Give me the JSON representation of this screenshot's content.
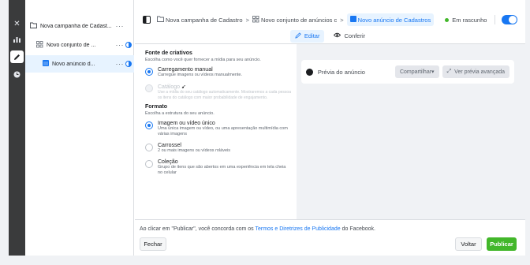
{
  "rail": {
    "close_icon": "close-icon",
    "chart_icon": "bar-chart-icon",
    "edit_icon": "pencil-icon",
    "history_icon": "clock-icon"
  },
  "tree": {
    "campaign": {
      "label": "Nova campanha de Cadast..."
    },
    "adset": {
      "label": "Novo conjunto de ..."
    },
    "ad": {
      "label": "Novo anúncio d..."
    },
    "more": "···"
  },
  "breadcrumb": {
    "campaign": "Nova campanha de Cadastro",
    "adset": "Novo conjunto de anúncios c",
    "ad": "Novo anúncio de Cadastros"
  },
  "status": {
    "label": "Em rascunho"
  },
  "tabs": {
    "edit": "Editar",
    "review": "Conferir"
  },
  "form": {
    "source_title": "Fonte de criativos",
    "source_desc": "Escolha como você quer fornecer a mídia para seu anúncio.",
    "manual_title": "Carregamento manual",
    "manual_desc": "Carregue imagens ou vídeos manualmente.",
    "catalog_title": "Catálogo",
    "catalog_desc": "Use a mídia do seu catálogo automaticamente. Mostraremos a cada pessoa os itens do catálogo com maior probabilidade de engajamento.",
    "format_title": "Formato",
    "format_desc": "Escolha a estrutura do seu anúncio.",
    "single_title": "Imagem ou vídeo único",
    "single_desc": "Uma única imagem ou vídeo, ou uma apresentação multimídia com várias imagens",
    "carousel_title": "Carrossel",
    "carousel_desc": "2 ou mais imagens ou vídeos roláveis",
    "collection_title": "Coleção",
    "collection_desc": "Grupo de itens que são abertos em uma experiência em tela cheia no celular"
  },
  "preview": {
    "label": "Prévia do anúncio",
    "share": "Compartilhar",
    "advanced": "Ver prévia avançada"
  },
  "footer": {
    "terms_prefix": "Ao clicar em \"Publicar\", você concorda com os ",
    "terms_link": "Termos e Diretrizes de Publicidade",
    "terms_suffix": " do Facebook.",
    "close": "Fechar",
    "back": "Voltar",
    "publish": "Publicar"
  },
  "colors": {
    "accent": "#1877f2",
    "publish": "#42b72a",
    "status_dot": "#42b72a",
    "rail": "#3a3b3c"
  }
}
